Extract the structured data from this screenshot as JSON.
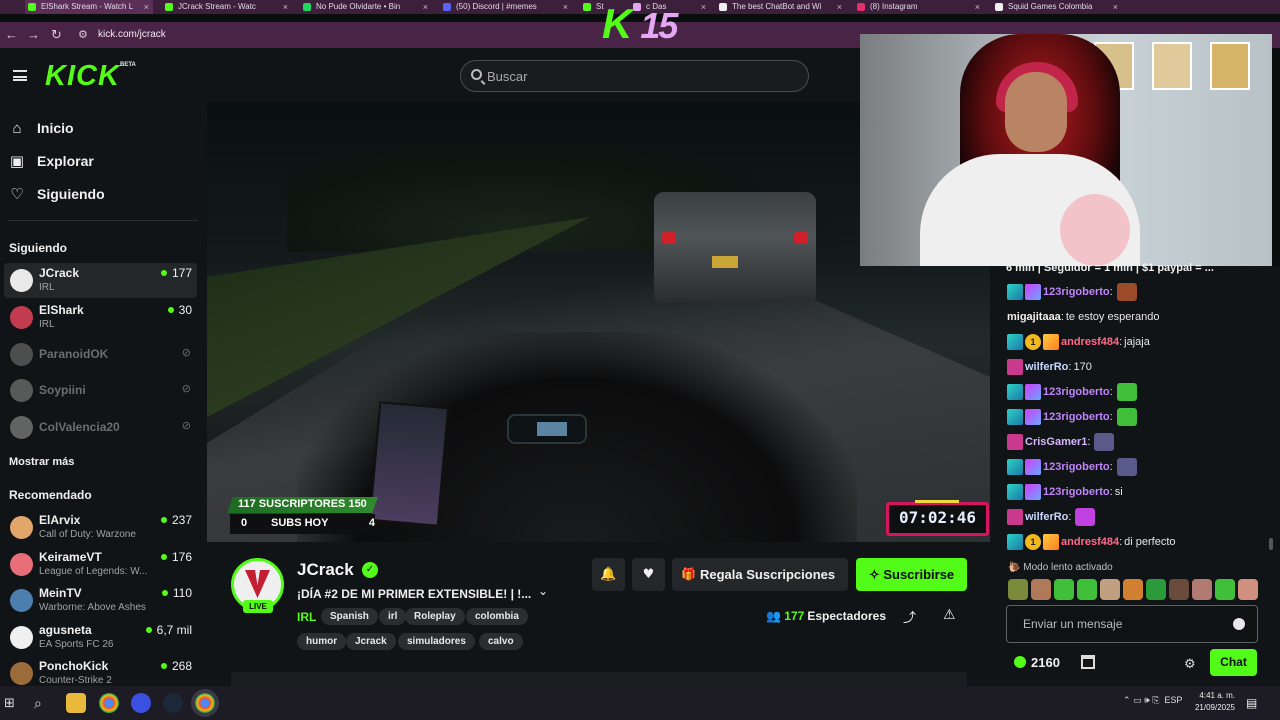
{
  "browser": {
    "tabs": [
      {
        "label": "ElShark Stream - Watch L",
        "active": true,
        "color": "#53fc18"
      },
      {
        "label": "JCrack Stream - Watc",
        "active": false,
        "color": "#53fc18"
      },
      {
        "label": "No Pude Olvidarte • Bin",
        "active": false,
        "color": "#1ed760"
      },
      {
        "label": "(50) Discord | #memes",
        "active": false,
        "color": "#5865f2"
      },
      {
        "label": "St",
        "active": false,
        "color": "#53fc18"
      },
      {
        "label": "c Das",
        "active": false,
        "color": "#e6a7f2"
      },
      {
        "label": "The best ChatBot and Wi",
        "active": false,
        "color": "#f0f0f0"
      },
      {
        "label": "(8) Instagram",
        "active": false,
        "color": "#e1306c"
      },
      {
        "label": "Squid Games Colombia",
        "active": false,
        "color": "#f0f0f0"
      }
    ],
    "url": "kick.com/jcrack"
  },
  "header": {
    "logo": "KICK",
    "logo_sup": "BETA",
    "search_placeholder": "Buscar"
  },
  "sidebar": {
    "nav": [
      {
        "label": "Inicio",
        "icon": "home-icon"
      },
      {
        "label": "Explorar",
        "icon": "explore-icon"
      },
      {
        "label": "Siguiendo",
        "icon": "heart-icon"
      }
    ],
    "following_title": "Siguiendo",
    "following": [
      {
        "name": "JCrack",
        "category": "IRL",
        "viewers": "177",
        "live": true
      },
      {
        "name": "ElShark",
        "category": "IRL",
        "viewers": "30",
        "live": true
      },
      {
        "name": "ParanoidOK",
        "live": false
      },
      {
        "name": "Soypiini",
        "live": false
      },
      {
        "name": "ColValencia20",
        "live": false
      }
    ],
    "show_more": "Mostrar más",
    "recommended_title": "Recomendado",
    "recommended": [
      {
        "name": "ElArvix",
        "category": "Call of Duty: Warzone",
        "viewers": "237"
      },
      {
        "name": "KeirameVT",
        "category": "League of Legends: W...",
        "viewers": "176"
      },
      {
        "name": "MeinTV",
        "category": "Warborne: Above Ashes",
        "viewers": "110"
      },
      {
        "name": "agusneta",
        "category": "EA Sports FC 26",
        "viewers": "6,7 mil"
      },
      {
        "name": "PonchoKick",
        "category": "Counter-Strike 2",
        "viewers": "268"
      }
    ]
  },
  "video_overlay": {
    "subs_top": "117 SUSCRIPTORES 150",
    "subs_left": "0",
    "subs_label": "SUBS HOY",
    "subs_right": "4",
    "timer": "07:02:46",
    "k15_k": "K",
    "k15_num": "15"
  },
  "stream": {
    "live_badge": "LIVE",
    "channel": "JCrack",
    "title": "¡DÍA #2 DE MI PRIMER EXTENSIBLE! | !...",
    "category": "IRL",
    "tags": [
      "Spanish",
      "irl",
      "Roleplay",
      "colombia",
      "humor",
      "Jcrack",
      "simuladores",
      "calvo"
    ],
    "gift_label": "Regala Suscripciones",
    "subscribe_label": "Suscribirse",
    "viewers_count": "177",
    "viewers_label": "Espectadores"
  },
  "chat": {
    "pinned": "6 min | Seguidor = 1 min | $1 paypal = ...",
    "messages": [
      {
        "badges": [
          "sub",
          "gift"
        ],
        "user": "123rigoberto",
        "color": "#c084fc",
        "text": "",
        "emote": "#9b4a2a"
      },
      {
        "badges": [],
        "user": "migajitaaa",
        "color": "#f0f0f0",
        "text": "te estoy esperando"
      },
      {
        "badges": [
          "sub",
          "one",
          "vip"
        ],
        "user": "andresf484",
        "color": "#ff6b8a",
        "text": "jajaja"
      },
      {
        "badges": [
          "kick"
        ],
        "user": "wilferRo",
        "color": "#c9d8ff",
        "text": "170"
      },
      {
        "badges": [
          "sub",
          "gift"
        ],
        "user": "123rigoberto",
        "color": "#c084fc",
        "text": "",
        "emote": "#3fbf3a"
      },
      {
        "badges": [
          "sub",
          "gift"
        ],
        "user": "123rigoberto",
        "color": "#c084fc",
        "text": "",
        "emote": "#3fbf3a"
      },
      {
        "badges": [
          "kick"
        ],
        "user": "CrisGamer1",
        "color": "#d6b7ff",
        "text": "",
        "emote": "#5a5a8a"
      },
      {
        "badges": [
          "sub",
          "gift"
        ],
        "user": "123rigoberto",
        "color": "#c084fc",
        "text": "",
        "emote": "#5a5a8a"
      },
      {
        "badges": [
          "sub",
          "gift"
        ],
        "user": "123rigoberto",
        "color": "#c084fc",
        "text": "si"
      },
      {
        "badges": [
          "kick"
        ],
        "user": "wilferRo",
        "color": "#c9d8ff",
        "text": "",
        "emote": "#c040e0"
      },
      {
        "badges": [
          "sub",
          "one",
          "vip"
        ],
        "user": "andresf484",
        "color": "#ff6b8a",
        "text": "di perfecto"
      }
    ],
    "slow_mode": "Modo lento activado",
    "emote_colors": [
      "#7a8a3a",
      "#b07a5a",
      "#3fbf3a",
      "#3fbf3a",
      "#c0a080",
      "#d08030",
      "#2a9a3a",
      "#6a4a3a",
      "#b07a70",
      "#3fbf3a",
      "#d09080"
    ],
    "input_placeholder": "Enviar un mensaje",
    "points": "2160",
    "chat_button": "Chat"
  },
  "taskbar": {
    "lang": "ESP",
    "time": "4:41 a. m.",
    "date": "21/09/2025"
  }
}
